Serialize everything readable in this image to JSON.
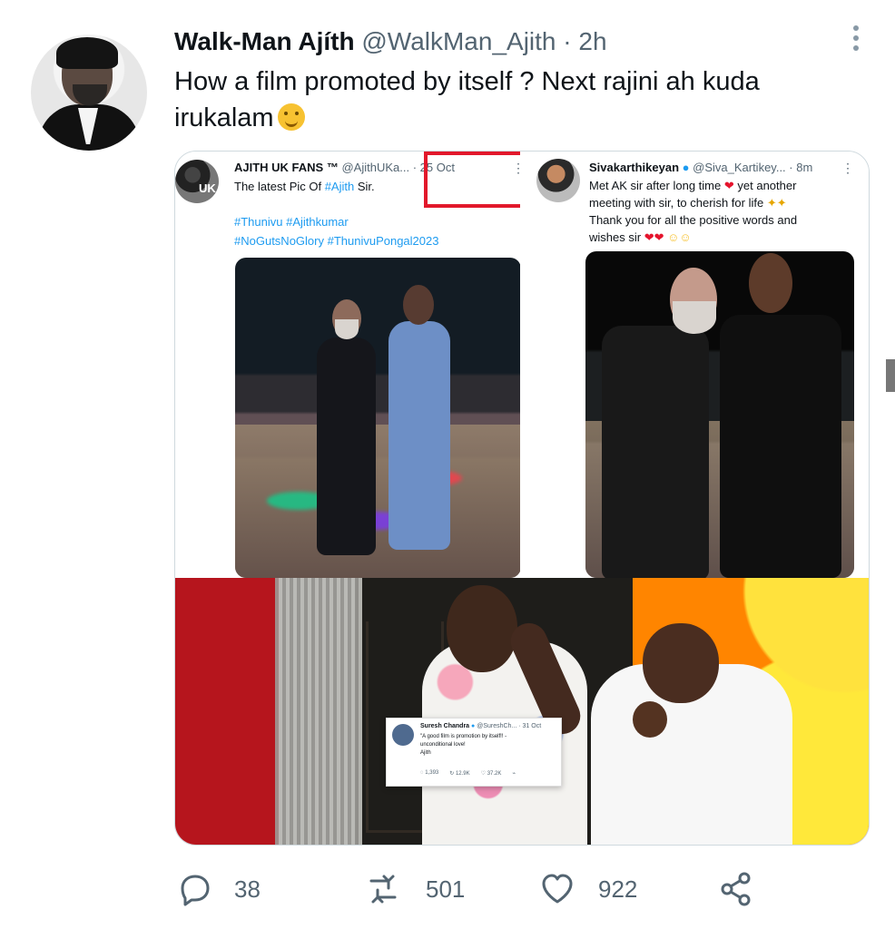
{
  "tweet": {
    "author_name": "Walk-Man Ajíth",
    "handle": "@WalkMan_Ajith",
    "separator": "·",
    "time": "2h",
    "text": "How a film promoted by itself ? Next rajini ah kuda irukalam",
    "emoji": "hugging-face-emoji"
  },
  "embedded_left": {
    "author": "AJITH UK FANS ™",
    "handle": "@AjithUK",
    "truncated": "a...",
    "date": "· 25 Oct",
    "line1_prefix": "The latest Pic Of ",
    "line1_hashtag": "#Ajith",
    "line1_suffix": " Sir.",
    "hashtags1": "#Thunivu #Ajithkumar",
    "hashtags2": "#NoGutsNoGlory #ThunivuPongal2023",
    "avatar_text": "UK"
  },
  "embedded_right": {
    "author": "Sivakarthikeyan",
    "handle": "@Siva_Kartikey...",
    "time": "· 8m",
    "line1": "Met AK sir after long time",
    "line1_end": "yet another",
    "line2": "meeting with sir, to cherish for life",
    "line3": "Thank you for all the  positive words and",
    "line4": "wishes sir"
  },
  "quote_card": {
    "author": "Suresh Chandra",
    "handle": "@SureshCh...",
    "date": "· 31 Oct",
    "line1": "\"A good film is promotion by itself!! -",
    "line2": "unconditional love!",
    "line3": "Ajith",
    "replies": "1,393",
    "retweets": "12.9K",
    "likes": "37.2K"
  },
  "counts": {
    "replies": "38",
    "retweets": "501",
    "likes": "922"
  },
  "colors": {
    "twitter_blue": "#1d9bf0",
    "muted_gray": "#536471",
    "highlight_red": "#e2182b"
  }
}
